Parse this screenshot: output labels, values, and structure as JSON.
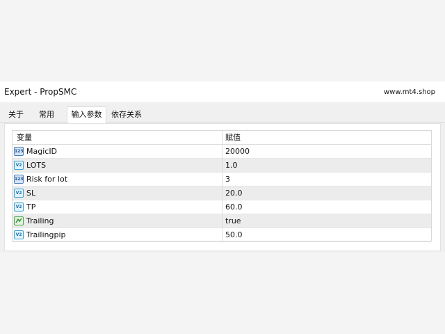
{
  "window": {
    "title": "Expert - PropSMC",
    "site": "www.mt4.shop"
  },
  "tabs": [
    {
      "label": "关于"
    },
    {
      "label": "常用"
    },
    {
      "label": "输入参数",
      "active": true
    },
    {
      "label": "依存关系"
    }
  ],
  "table": {
    "headers": {
      "variable": "变量",
      "value": "赋值"
    },
    "rows": [
      {
        "name": "MagicID",
        "value": "20000",
        "icon": "int-icon"
      },
      {
        "name": "LOTS",
        "value": "1.0",
        "icon": "double-icon"
      },
      {
        "name": "Risk for lot",
        "value": "3",
        "icon": "int-icon"
      },
      {
        "name": "SL",
        "value": "20.0",
        "icon": "double-icon"
      },
      {
        "name": "TP",
        "value": "60.0",
        "icon": "double-icon"
      },
      {
        "name": "Trailing",
        "value": "true",
        "icon": "bool-icon"
      },
      {
        "name": "Trailingpip",
        "value": "50.0",
        "icon": "double-icon"
      }
    ],
    "icon_text": {
      "int": "123",
      "double": "V2"
    }
  }
}
